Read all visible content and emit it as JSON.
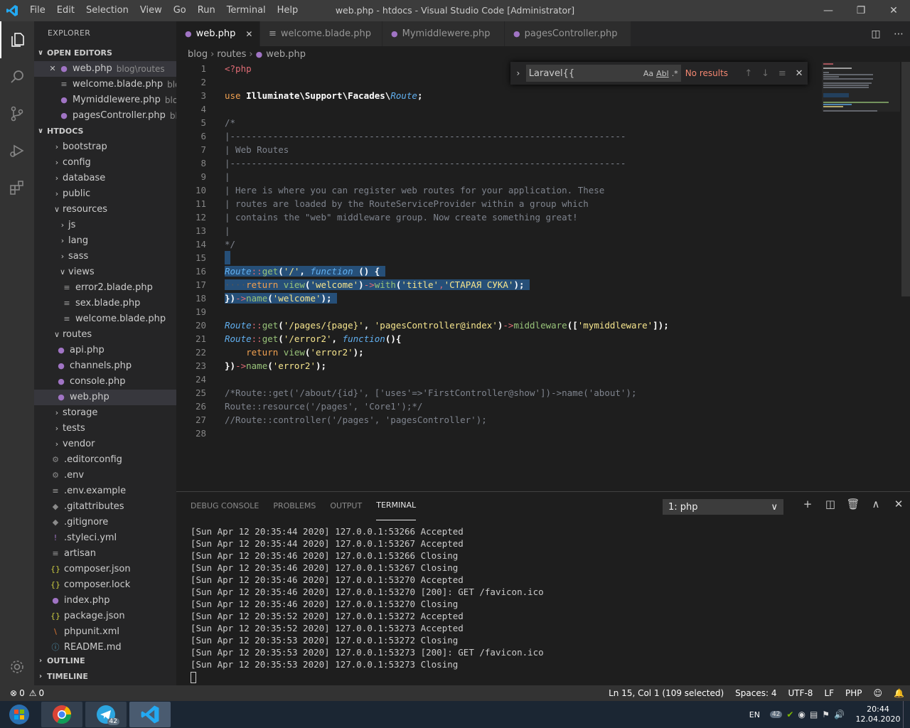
{
  "titlebar": {
    "menu": [
      "File",
      "Edit",
      "Selection",
      "View",
      "Go",
      "Run",
      "Terminal",
      "Help"
    ],
    "title": "web.php - htdocs - Visual Studio Code [Administrator]"
  },
  "sidebar": {
    "title": "EXPLORER",
    "open_editors_label": "OPEN EDITORS",
    "open_editors": [
      {
        "name": "web.php",
        "desc": "blog\\routes",
        "close": "✕"
      },
      {
        "name": "welcome.blade.php",
        "desc": "blo..."
      },
      {
        "name": "Mymiddlewere.php",
        "desc": "blo..."
      },
      {
        "name": "pagesController.php",
        "desc": "bl..."
      }
    ],
    "htdocs_label": "HTDOCS",
    "tree": [
      {
        "name": "bootstrap"
      },
      {
        "name": "config"
      },
      {
        "name": "database"
      },
      {
        "name": "public"
      },
      {
        "name": "resources"
      },
      {
        "name": "js"
      },
      {
        "name": "lang"
      },
      {
        "name": "sass"
      },
      {
        "name": "views"
      },
      {
        "name": "error2.blade.php"
      },
      {
        "name": "sex.blade.php"
      },
      {
        "name": "welcome.blade.php"
      },
      {
        "name": "routes"
      },
      {
        "name": "api.php"
      },
      {
        "name": "channels.php"
      },
      {
        "name": "console.php"
      },
      {
        "name": "web.php"
      },
      {
        "name": "storage"
      },
      {
        "name": "tests"
      },
      {
        "name": "vendor"
      },
      {
        "name": ".editorconfig"
      },
      {
        "name": ".env"
      },
      {
        "name": ".env.example"
      },
      {
        "name": ".gitattributes"
      },
      {
        "name": ".gitignore"
      },
      {
        "name": ".styleci.yml"
      },
      {
        "name": "artisan"
      },
      {
        "name": "composer.json"
      },
      {
        "name": "composer.lock"
      },
      {
        "name": "index.php"
      },
      {
        "name": "package.json"
      },
      {
        "name": "phpunit.xml"
      },
      {
        "name": "README.md"
      }
    ],
    "outline_label": "OUTLINE",
    "timeline_label": "TIMELINE"
  },
  "tabs": [
    {
      "label": "web.php",
      "close": "✕"
    },
    {
      "label": "welcome.blade.php"
    },
    {
      "label": "Mymiddlewere.php"
    },
    {
      "label": "pagesController.php"
    }
  ],
  "breadcrumb": [
    "blog",
    "routes",
    "web.php"
  ],
  "editor": {
    "line_numbers": [
      "1",
      "2",
      "3",
      "4",
      "5",
      "6",
      "7",
      "8",
      "9",
      "10",
      "11",
      "12",
      "13",
      "14",
      "15",
      "16",
      "17",
      "18",
      "19",
      "20",
      "21",
      "22",
      "23",
      "24",
      "25",
      "26",
      "27",
      "28"
    ],
    "code": {
      "l1": "<?php",
      "l3a": "use ",
      "l3b": "Illuminate\\Support\\Facades\\",
      "l3c": "Route",
      "l3d": ";",
      "l5": "/*",
      "l6": "|--------------------------------------------------------------------------",
      "l7": "| Web Routes",
      "l8": "|--------------------------------------------------------------------------",
      "l9": "|",
      "l10": "| Here is where you can register web routes for your application. These",
      "l11": "| routes are loaded by the RouteServiceProvider within a group which",
      "l12": "| contains the \"web\" middleware group. Now create something great!",
      "l13": "|",
      "l14": "*/",
      "l16a": "Route",
      "l16b": "::",
      "l16c": "get",
      "l16d": "(",
      "l16e": "'/'",
      "l16f": ", ",
      "l16g": "function",
      "l16h": " () {",
      "l17a": "····",
      "l17b": "return",
      "l17c": " view",
      "l17d": "(",
      "l17e": "'welcome'",
      "l17f": ")",
      "l17g": "->",
      "l17h": "with",
      "l17i": "(",
      "l17j": "'title'",
      "l17k": ",",
      "l17l": "'СТАРАЯ СУКА'",
      "l17m": ");",
      "l18a": "})",
      "l18b": "->",
      "l18c": "name",
      "l18d": "(",
      "l18e": "'welcome'",
      "l18f": ");",
      "l20a": "Route",
      "l20b": "::",
      "l20c": "get",
      "l20d": "(",
      "l20e": "'/pages/{page}'",
      "l20f": ", ",
      "l20g": "'pagesController@index'",
      "l20h": ")",
      "l20i": "->",
      "l20j": "middleware",
      "l20k": "([",
      "l20l": "'mymiddleware'",
      "l20m": "]);",
      "l21a": "Route",
      "l21b": "::",
      "l21c": "get",
      "l21d": "(",
      "l21e": "'/error2'",
      "l21f": ", ",
      "l21g": "function",
      "l21h": "(){",
      "l22a": "    ",
      "l22b": "return",
      "l22c": " view",
      "l22d": "(",
      "l22e": "'error2'",
      "l22f": ");",
      "l23a": "})",
      "l23b": "->",
      "l23c": "name",
      "l23d": "(",
      "l23e": "'error2'",
      "l23f": ");",
      "l25": "/*Route::get('/about/{id}', ['uses'=>'FirstController@show'])->name('about');",
      "l26": "Route::resource('/pages', 'Core1');*/",
      "l27": "//Route::controller('/pages', 'pagesController');"
    }
  },
  "find_widget": {
    "value": "Laravel{{",
    "opt_case": "Aa",
    "opt_word": "Abl",
    "opt_regex": ".*",
    "no_results": "No results"
  },
  "panel": {
    "tabs": [
      "DEBUG CONSOLE",
      "PROBLEMS",
      "OUTPUT",
      "TERMINAL"
    ],
    "select_value": "1: php",
    "terminal_lines": [
      "[Sun Apr 12 20:35:44 2020] 127.0.0.1:53266 Accepted",
      "[Sun Apr 12 20:35:44 2020] 127.0.0.1:53267 Accepted",
      "[Sun Apr 12 20:35:46 2020] 127.0.0.1:53266 Closing",
      "[Sun Apr 12 20:35:46 2020] 127.0.0.1:53267 Closing",
      "[Sun Apr 12 20:35:46 2020] 127.0.0.1:53270 Accepted",
      "[Sun Apr 12 20:35:46 2020] 127.0.0.1:53270 [200]: GET /favicon.ico",
      "[Sun Apr 12 20:35:46 2020] 127.0.0.1:53270 Closing",
      "[Sun Apr 12 20:35:52 2020] 127.0.0.1:53272 Accepted",
      "[Sun Apr 12 20:35:52 2020] 127.0.0.1:53273 Accepted",
      "[Sun Apr 12 20:35:53 2020] 127.0.0.1:53272 Closing",
      "[Sun Apr 12 20:35:53 2020] 127.0.0.1:53273 [200]: GET /favicon.ico",
      "[Sun Apr 12 20:35:53 2020] 127.0.0.1:53273 Closing"
    ]
  },
  "statusbar": {
    "errors": "0",
    "warnings": "0",
    "position": "Ln 15, Col 1 (109 selected)",
    "spaces": "Spaces: 4",
    "encoding": "UTF-8",
    "eol": "LF",
    "language": "PHP"
  },
  "taskbar": {
    "telegram_badge": "42",
    "lang": "EN",
    "tray_badge": "42",
    "time": "20:44",
    "date": "12.04.2020"
  }
}
